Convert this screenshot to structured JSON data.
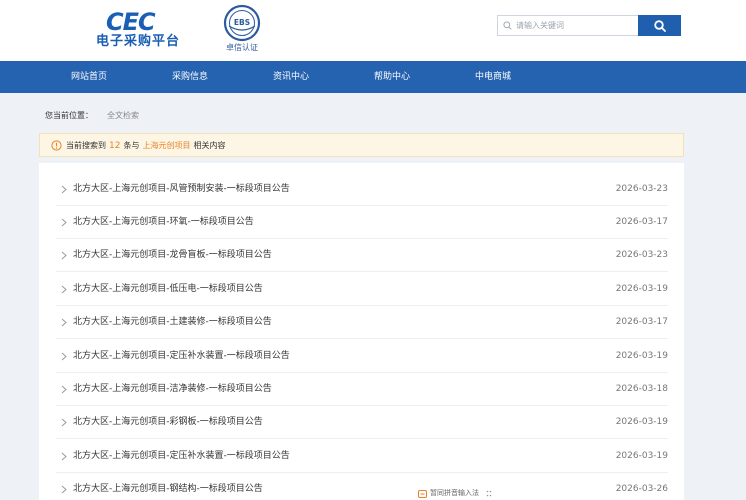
{
  "header": {
    "logo_main": "CEC",
    "logo_sub": "电子采购平台",
    "ebs_logo_text": "EBS",
    "ebs_label": "卓信认证",
    "search_placeholder": "请输入关键词"
  },
  "nav": {
    "items": [
      "网站首页",
      "采购信息",
      "资讯中心",
      "帮助中心",
      "中电商城"
    ]
  },
  "breadcrumb": {
    "label": "您当前位置：",
    "current": "全文检索"
  },
  "notice": {
    "prefix": "当前搜索到",
    "count": "12",
    "middle": "条与",
    "keyword": "上海元创项目",
    "suffix": "相关内容"
  },
  "results": [
    {
      "title": "北方大区-上海元创项目-风管预制安装-一标段项目公告",
      "date": "2026-03-23"
    },
    {
      "title": "北方大区-上海元创项目-环氧-一标段项目公告",
      "date": "2026-03-17"
    },
    {
      "title": "北方大区-上海元创项目-龙骨盲板-一标段项目公告",
      "date": "2026-03-23"
    },
    {
      "title": "北方大区-上海元创项目-低压电-一标段项目公告",
      "date": "2026-03-19"
    },
    {
      "title": "北方大区-上海元创项目-土建装修-一标段项目公告",
      "date": "2026-03-17"
    },
    {
      "title": "北方大区-上海元创项目-定压补水装置-一标段项目公告",
      "date": "2026-03-19"
    },
    {
      "title": "北方大区-上海元创项目-洁净装修-一标段项目公告",
      "date": "2026-03-18"
    },
    {
      "title": "北方大区-上海元创项目-彩钢板-一标段项目公告",
      "date": "2026-03-19"
    },
    {
      "title": "北方大区-上海元创项目-定压补水装置-一标段项目公告",
      "date": "2026-03-19"
    },
    {
      "title": "北方大区-上海元创项目-钢结构-一标段项目公告",
      "date": "2026-03-26"
    }
  ],
  "ime": {
    "label": "暂同拼音输入法"
  },
  "colors": {
    "brand_blue": "#2562b0",
    "accent_orange": "#e8832a",
    "notice_bg": "#fdf6e4"
  }
}
